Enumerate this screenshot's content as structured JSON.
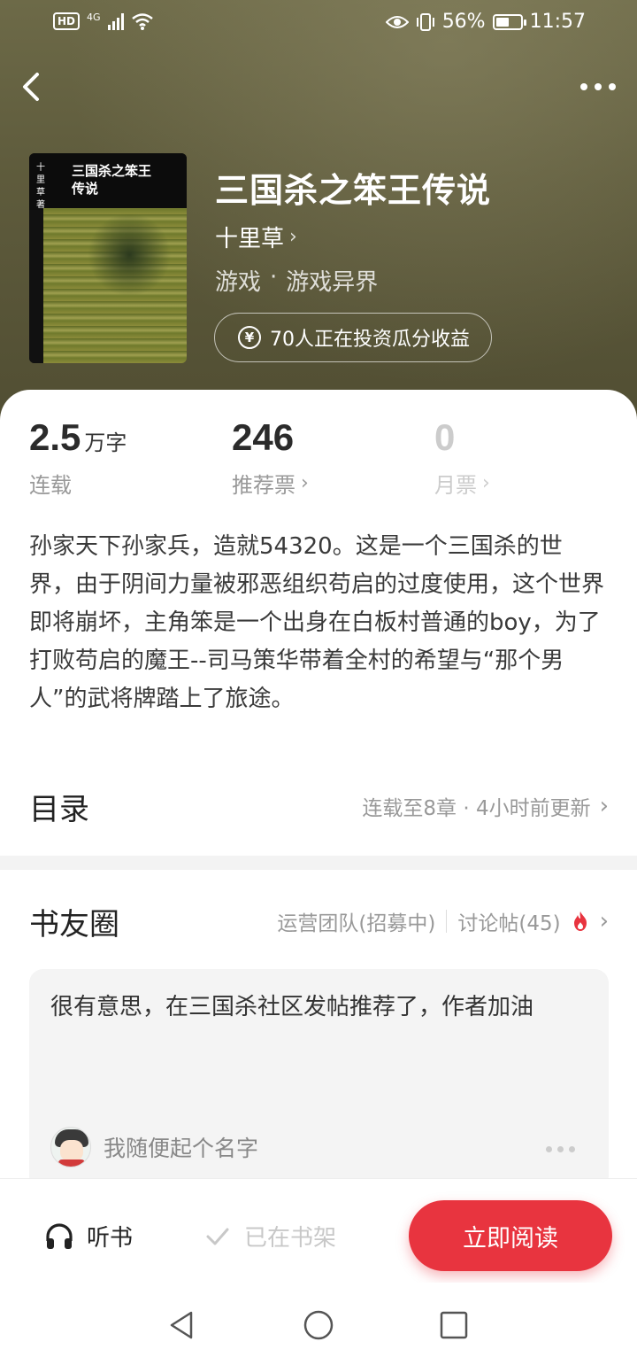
{
  "status_bar": {
    "hd": "HD",
    "network": "4G",
    "battery_text": "56%",
    "battery_level": 0.56,
    "time": "11:57"
  },
  "nav": {
    "back_icon": "chevron-left-icon",
    "more_icon": "more-dots-icon"
  },
  "book": {
    "cover_title": "三国杀之笨王传说",
    "cover_author": "十里草著",
    "title": "三国杀之笨王传说",
    "author": "十里草",
    "genre": "游戏",
    "sep": "·",
    "subgenre": "游戏异界",
    "invest_text": "70人正在投资瓜分收益"
  },
  "stats": [
    {
      "value": "2.5",
      "unit": "万字",
      "label": "连载"
    },
    {
      "value": "246",
      "unit": "",
      "label": "推荐票"
    },
    {
      "value": "0",
      "unit": "",
      "label": "月票"
    }
  ],
  "synopsis": "孙家天下孙家兵，造就54320。这是一个三国杀的世界，由于阴间力量被邪恶组织苟启的过度使用，这个世界即将崩坏，主角笨是一个出身在白板村普通的boy，为了打败苟启的魔王--司马策华带着全村的希望与“那个男人”的武将牌踏上了旅途。",
  "toc": {
    "title": "目录",
    "meta": "连载至8章 · 4小时前更新"
  },
  "circle": {
    "title": "书友圈",
    "team": "运营团队(招募中)",
    "posts": "讨论帖(45)"
  },
  "post": {
    "text": "很有意思，在三国杀社区发帖推荐了，作者加油",
    "username": "我随便起个名字"
  },
  "bottom_bar": {
    "listen_label": "听书",
    "shelf_label": "已在书架",
    "read_label": "立即阅读"
  },
  "colors": {
    "accent": "#e8343f",
    "hero_bg": "#5e5b3c"
  }
}
